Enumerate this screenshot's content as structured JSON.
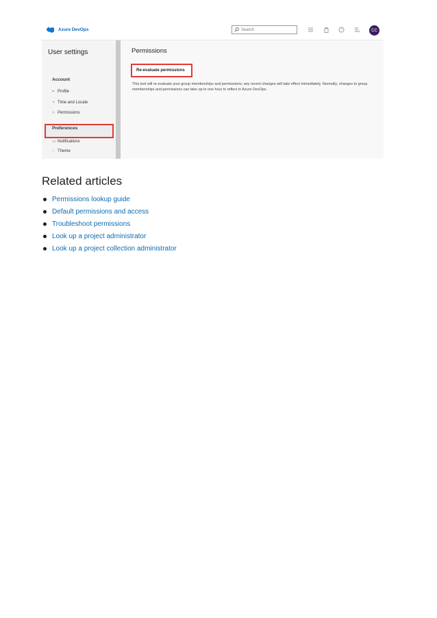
{
  "screenshot": {
    "brand": "Azure DevOps",
    "search_placeholder": "Search",
    "avatar_initials": "CC",
    "sidebar": {
      "title": "User settings",
      "sections": [
        {
          "label": "Account",
          "items": [
            {
              "label": "Profile",
              "icon": "profile-icon"
            },
            {
              "label": "Time and Locale",
              "icon": "clock-icon"
            },
            {
              "label": "Permissions",
              "icon": "refresh-icon",
              "selected": true
            }
          ]
        },
        {
          "label": "Preferences",
          "items": [
            {
              "label": "Notifications",
              "icon": "notification-icon"
            },
            {
              "label": "Theme",
              "icon": "theme-icon"
            }
          ]
        }
      ]
    },
    "main": {
      "title": "Permissions",
      "button_label": "Re-evaluate permissions",
      "description": "This tool will re-evaluate your group memberships and permissions; any recent changes will take effect immediately. Normally, changes to group memberships and permissions can take up to one hour to reflect in Azure DevOps."
    },
    "highlight_color": "#e03838"
  },
  "related": {
    "heading": "Related articles",
    "links": [
      "Permissions lookup guide",
      "Default permissions and access",
      "Troubleshoot permissions",
      "Look up a project administrator",
      "Look up a project collection administrator"
    ],
    "link_color": "#0a6bb0"
  }
}
